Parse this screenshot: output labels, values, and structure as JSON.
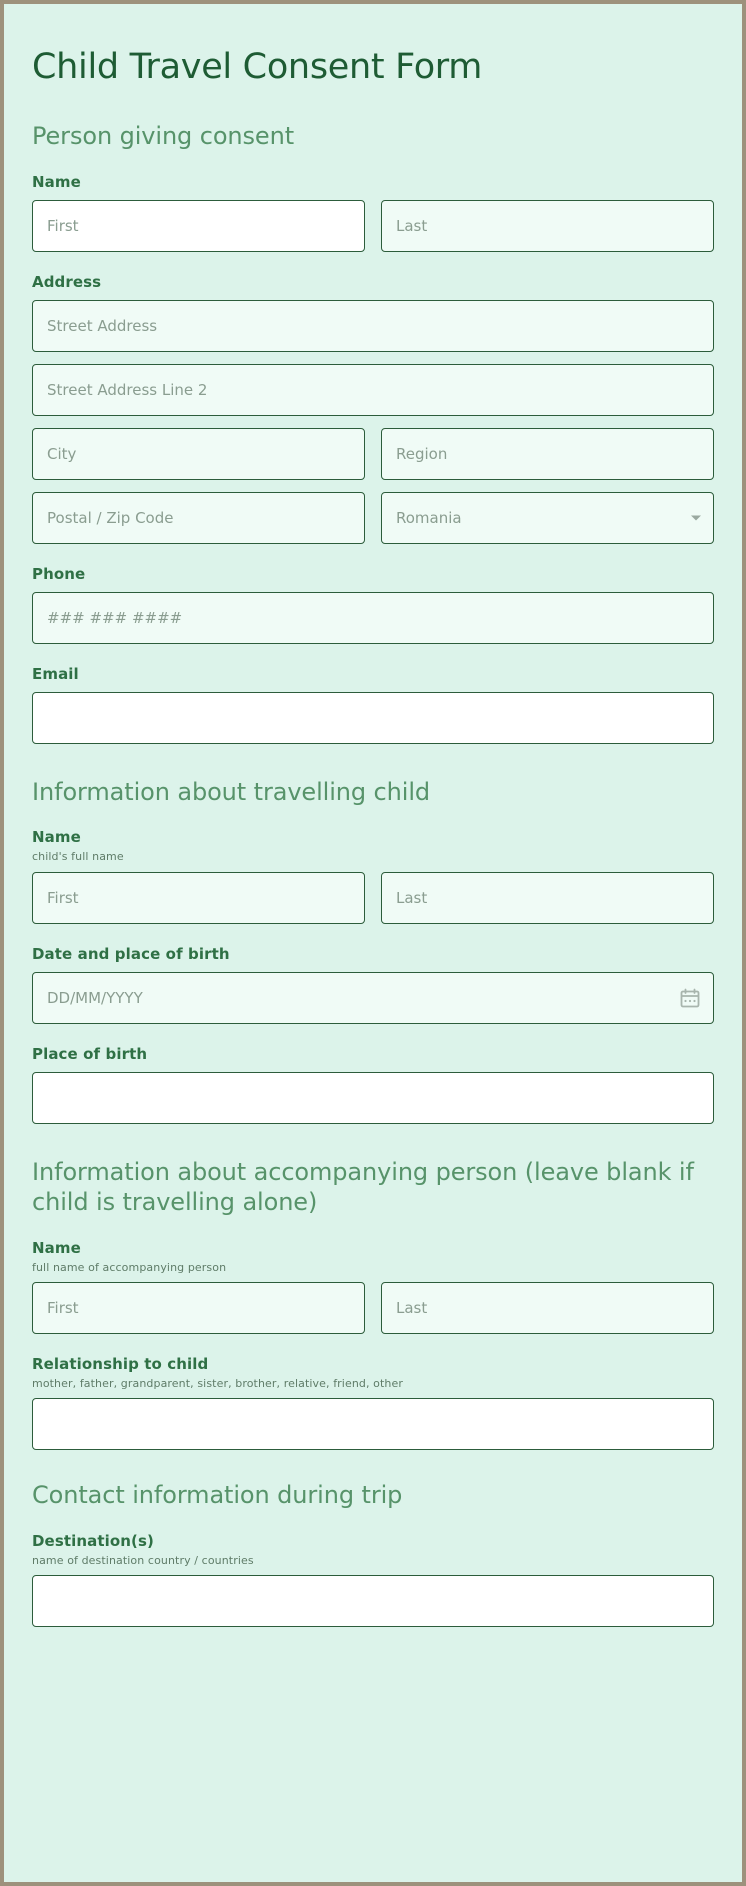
{
  "form": {
    "title": "Child Travel Consent Form"
  },
  "sections": {
    "consent_giver": {
      "heading": "Person giving consent",
      "name": {
        "label": "Name",
        "first_placeholder": "First",
        "last_placeholder": "Last"
      },
      "address": {
        "label": "Address",
        "street_placeholder": "Street Address",
        "street2_placeholder": "Street Address Line 2",
        "city_placeholder": "City",
        "region_placeholder": "Region",
        "postal_placeholder": "Postal / Zip Code",
        "country_value": "Romania"
      },
      "phone": {
        "label": "Phone",
        "placeholder": "### ### ####"
      },
      "email": {
        "label": "Email",
        "placeholder": ""
      }
    },
    "child": {
      "heading": "Information about travelling child",
      "name": {
        "label": "Name",
        "sublabel": "child's full name",
        "first_placeholder": "First",
        "last_placeholder": "Last"
      },
      "dob": {
        "label": "Date and place of birth",
        "placeholder": "DD/MM/YYYY"
      },
      "place_of_birth": {
        "label": "Place of birth",
        "placeholder": ""
      }
    },
    "accompanying": {
      "heading": "Information about accompanying person (leave blank if child is travelling alone)",
      "name": {
        "label": "Name",
        "sublabel": "full name of accompanying person",
        "first_placeholder": "First",
        "last_placeholder": "Last"
      },
      "relationship": {
        "label": "Relationship to child",
        "sublabel": "mother, father, grandparent, sister, brother, relative, friend, other",
        "placeholder": ""
      }
    },
    "contact_trip": {
      "heading": "Contact information during trip",
      "destinations": {
        "label": "Destination(s)",
        "sublabel": "name of destination country / countries",
        "placeholder": ""
      }
    }
  },
  "icons": {
    "calendar": "calendar-icon",
    "dropdown": "chevron-down-icon"
  },
  "colors": {
    "page_background": "#dcf3ea",
    "outer_border": "#9d917c",
    "title_text": "#1e5c34",
    "section_heading_text": "#57936a",
    "label_text": "#2f7045",
    "sublabel_text": "#5f7c68",
    "input_background": "#f0fbf6",
    "input_border": "#2c5c3b",
    "placeholder_text": "#8a9d90"
  }
}
